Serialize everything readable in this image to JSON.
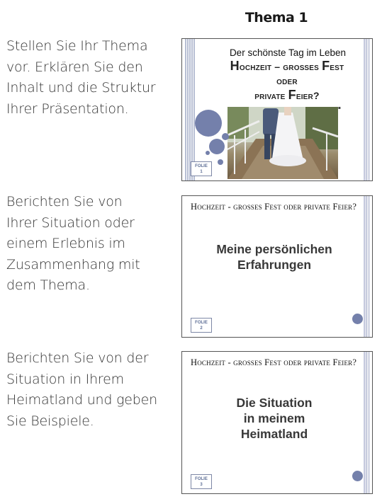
{
  "page": {
    "title": "Thema 1"
  },
  "instructions": [
    {
      "lines": [
        "Stellen Sie Ihr Thema",
        "vor. Erklären Sie den",
        "Inhalt und die Struktur",
        "Ihrer Präsentation."
      ]
    },
    {
      "lines": [
        "Berichten Sie von",
        "Ihrer Situation oder",
        "einem Erlebnis im",
        "Zusammenhang mit",
        "dem Thema."
      ]
    },
    {
      "lines": [
        "Berichten Sie von der",
        "Situation in Ihrem",
        "Heimatland und geben",
        "Sie Beispiele."
      ]
    }
  ],
  "slides": [
    {
      "subtitle": "Der schönste Tag im Leben",
      "title_line1_cap1": "H",
      "title_line1_rest1": "ochzeit – groß",
      "title_line1_rest2": "es ",
      "title_line1_cap2": "F",
      "title_line1_rest3": "est",
      "title_line2": "oder",
      "title_line3_pre": "private ",
      "title_line3_cap": "F",
      "title_line3_rest": "eier?",
      "folie_label": "FOLIE",
      "folie_num": "1",
      "photo": "wedding-couple-on-bridge"
    },
    {
      "header": "Hochzeit - großes Fest oder private Feier?",
      "body_lines": [
        "Meine persönlichen",
        "Erfahrungen"
      ],
      "folie_label": "FOLIE",
      "folie_num": "2"
    },
    {
      "header": "Hochzeit - großes Fest oder private Feier?",
      "body_lines": [
        "Die Situation",
        "in meinem",
        "Heimatland"
      ],
      "folie_label": "FOLIE",
      "folie_num": "3"
    }
  ],
  "colors": {
    "accent_circle": "#7480ab",
    "stripe": "#b7bed3",
    "folie_text": "#5d6e96"
  }
}
